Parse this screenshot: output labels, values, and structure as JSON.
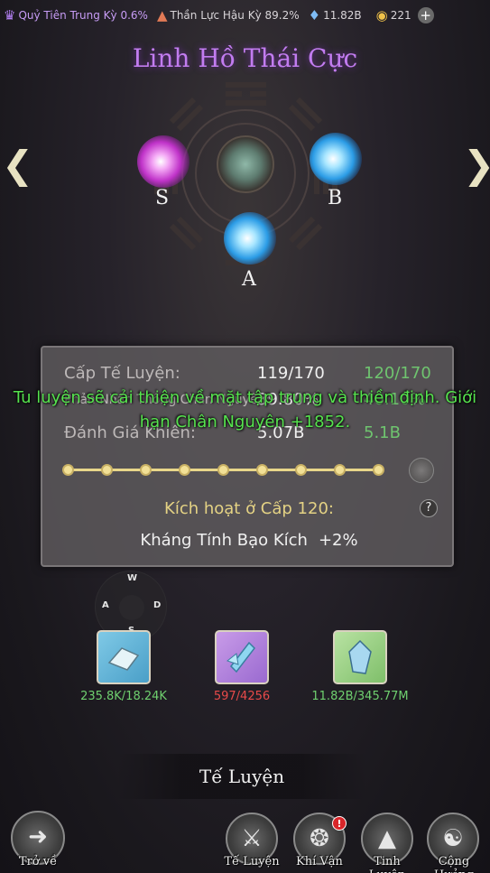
{
  "topbar": {
    "realm1": "Quỷ Tiên Trung Kỳ 0.6%",
    "realm2": "Thần Lực Hậu Kỳ 89.2%",
    "stone": "11.82B",
    "gold": "221",
    "plus": "+"
  },
  "title": "Linh Hồ Thái Cực",
  "orbs": {
    "s": "S",
    "b": "B",
    "a": "A"
  },
  "stats": {
    "rows": [
      {
        "label": "Cấp Tế Luyện:",
        "current": "119/170",
        "next": "120/170"
      },
      {
        "label": "Phản Nhấn Thông Chân Nguyên:",
        "current": "39.80%",
        "next": "40.10%"
      },
      {
        "label": "Đánh Giá Khiên:",
        "current": "5.07B",
        "next": "5.1B"
      }
    ]
  },
  "progress": {
    "filled_dots": 9,
    "total_dots": 10
  },
  "activate_text": "Kích hoạt ở Cấp 120:",
  "help": "?",
  "bonus": {
    "name": "Kháng Tính Bạo Kích",
    "value": "+2%"
  },
  "overlay_message": "Tu luyện sẽ cải thiện về mặt tập trung và thiền định. Giới hạn Chân Nguyên +1852.",
  "compass": {
    "w": "W",
    "a": "A",
    "d": "D",
    "s": "S"
  },
  "materials": [
    {
      "count": "235.8K/18.24K",
      "color": "#6fd06f"
    },
    {
      "count": "597/4256",
      "color": "#e84a4a"
    },
    {
      "count": "11.82B/345.77M",
      "color": "#6fd06f"
    }
  ],
  "refine_button": "Tế Luyện",
  "nav": {
    "back": "Trở về",
    "items": [
      "Tế Luyện",
      "Khí Vận",
      "Tinh Luyện",
      "Cộng Hưởng"
    ],
    "badge": "!"
  }
}
